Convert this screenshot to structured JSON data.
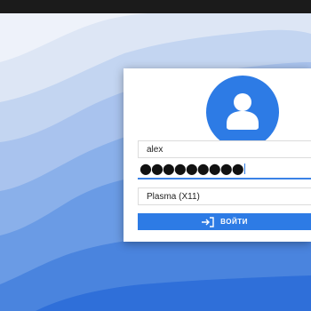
{
  "colors": {
    "accent": "#2d7be5",
    "wallpaper_light": "#e6edf8",
    "wallpaper_deep": "#2f6fd9",
    "topbar": "#1b1b1b"
  },
  "avatar": {
    "icon": "user-icon"
  },
  "username": {
    "value": "alex"
  },
  "password": {
    "masked": "●●●●●●●●●"
  },
  "session": {
    "value": "Plasma (X11)"
  },
  "login_button": {
    "label": "ВОЙТИ",
    "icon": "login-arrow-icon"
  }
}
